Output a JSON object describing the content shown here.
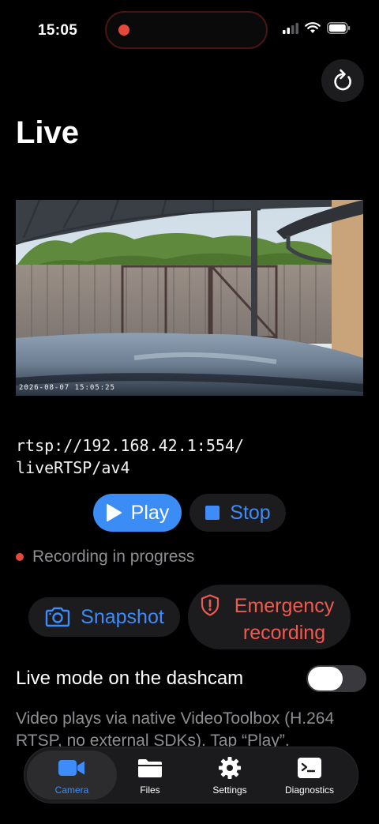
{
  "status_bar": {
    "time": "15:05"
  },
  "header": {
    "title": "Live"
  },
  "video": {
    "timestamp": "2026-08-07 15:05:25"
  },
  "stream": {
    "url": "rtsp://192.168.42.1:554/\nliveRTSP/av4"
  },
  "controls": {
    "play_label": "Play",
    "stop_label": "Stop"
  },
  "recording_status": "Recording in progress",
  "actions": {
    "snapshot_label": "Snapshot",
    "emergency_label": "Emergency recording"
  },
  "live_mode": {
    "label": "Live mode on the dashcam",
    "enabled": false
  },
  "info_text": "Video plays via native VideoToolbox (H.264 RTSP, no external SDKs). Tap “Play”.",
  "tabs": [
    {
      "label": "Camera",
      "icon": "video-camera-icon",
      "active": true
    },
    {
      "label": "Files",
      "icon": "folder-icon",
      "active": false
    },
    {
      "label": "Settings",
      "icon": "gear-icon",
      "active": false
    },
    {
      "label": "Diagnostics",
      "icon": "terminal-icon",
      "active": false
    }
  ],
  "colors": {
    "accent": "#3f8cf8",
    "danger": "#ef5a50",
    "background": "#000000",
    "card": "#1c1c1e"
  }
}
